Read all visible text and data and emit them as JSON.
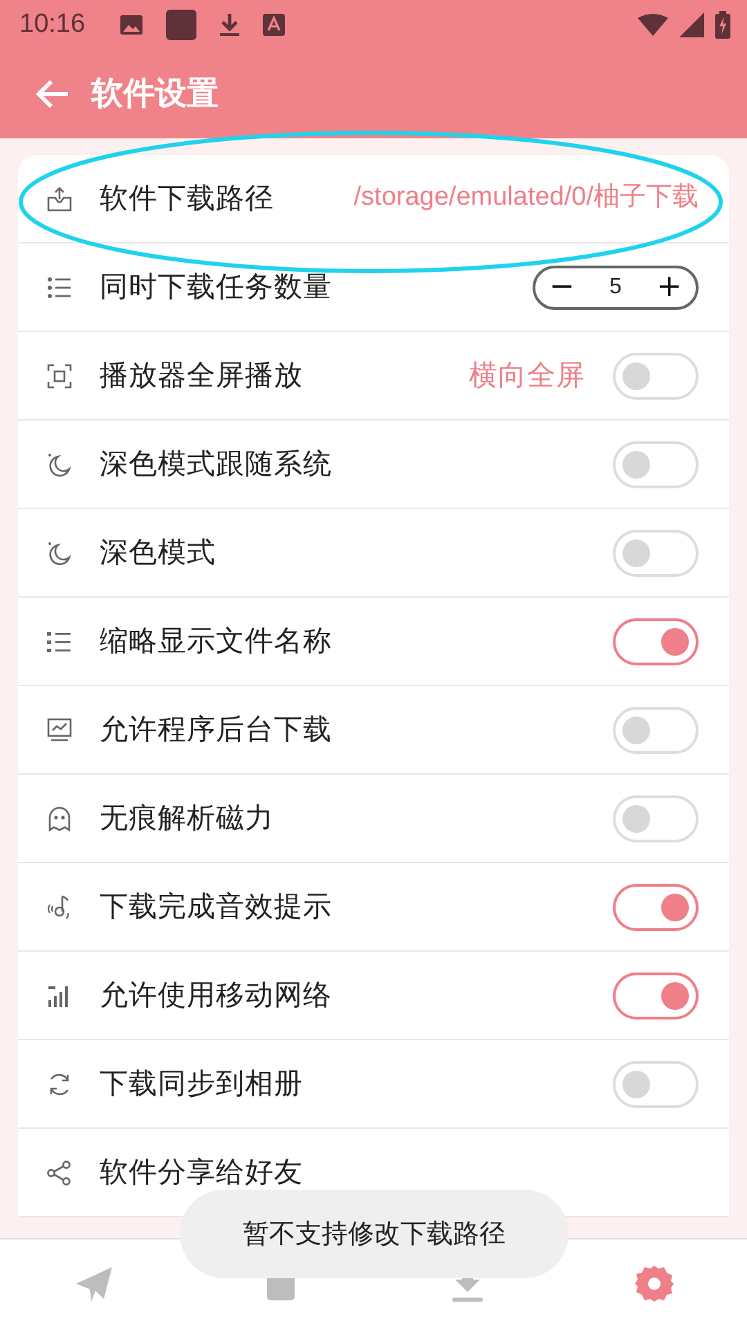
{
  "status_bar": {
    "time": "10:16"
  },
  "toolbar": {
    "title": "软件设置"
  },
  "settings": [
    {
      "kind": "path",
      "label": "软件下载路径",
      "value": "/storage/emulated/0/柚子下载",
      "highlighted": true
    },
    {
      "kind": "stepper",
      "label": "同时下载任务数量",
      "minus": "−",
      "value": "5",
      "plus": "+"
    },
    {
      "kind": "toggle",
      "label": "播放器全屏播放",
      "value": "横向全屏",
      "on": false
    },
    {
      "kind": "toggle",
      "label": "深色模式跟随系统",
      "on": false
    },
    {
      "kind": "toggle",
      "label": "深色模式",
      "on": false
    },
    {
      "kind": "toggle",
      "label": "缩略显示文件名称",
      "on": true
    },
    {
      "kind": "toggle",
      "label": "允许程序后台下载",
      "on": false
    },
    {
      "kind": "toggle",
      "label": "无痕解析磁力",
      "on": false
    },
    {
      "kind": "toggle",
      "label": "下载完成音效提示",
      "on": true
    },
    {
      "kind": "toggle",
      "label": "允许使用移动网络",
      "on": true
    },
    {
      "kind": "toggle",
      "label": "下载同步到相册",
      "on": false
    },
    {
      "kind": "link",
      "label": "软件分享给好友"
    }
  ],
  "toast": "暂不支持修改下载路径",
  "bottom_nav": [
    {
      "selected": false
    },
    {
      "selected": false
    },
    {
      "selected": false
    },
    {
      "selected": true
    }
  ]
}
